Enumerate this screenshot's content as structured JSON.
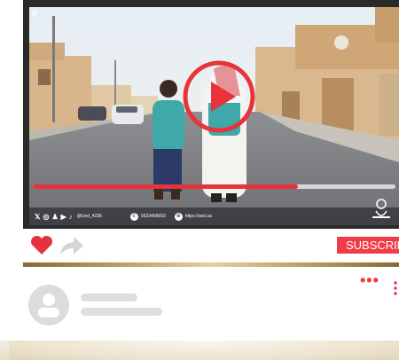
{
  "video": {
    "progress_fraction": 0.73,
    "handle": "@Ued_4236",
    "phone": "0533466693",
    "website": "https://ued.sa"
  },
  "actions": {
    "subscribe_label": "SUBSCRIBE"
  },
  "colors": {
    "accent": "#ef3c47",
    "progress": "#e8333a",
    "gold": "#c9a869"
  }
}
